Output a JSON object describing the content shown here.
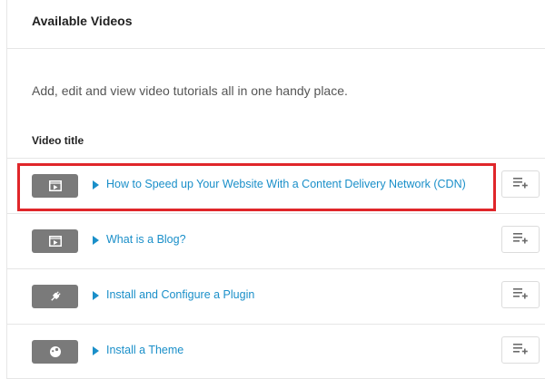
{
  "panel": {
    "title": "Available Videos",
    "description": "Add, edit and view video tutorials all in one handy place."
  },
  "table": {
    "column_header": "Video title",
    "rows": [
      {
        "title": "How to Speed up Your Website With a Content Delivery Network (CDN)",
        "icon": "video-icon",
        "highlighted": true
      },
      {
        "title": "What is a Blog?",
        "icon": "video-icon",
        "highlighted": false
      },
      {
        "title": "Install and Configure a Plugin",
        "icon": "plug-icon",
        "highlighted": false
      },
      {
        "title": "Install a Theme",
        "icon": "palette-icon",
        "highlighted": false
      }
    ]
  },
  "colors": {
    "link": "#1a8fc9",
    "thumbnail": "#7a7a7a",
    "highlight": "#e0262a",
    "border": "#e6e6e6"
  }
}
